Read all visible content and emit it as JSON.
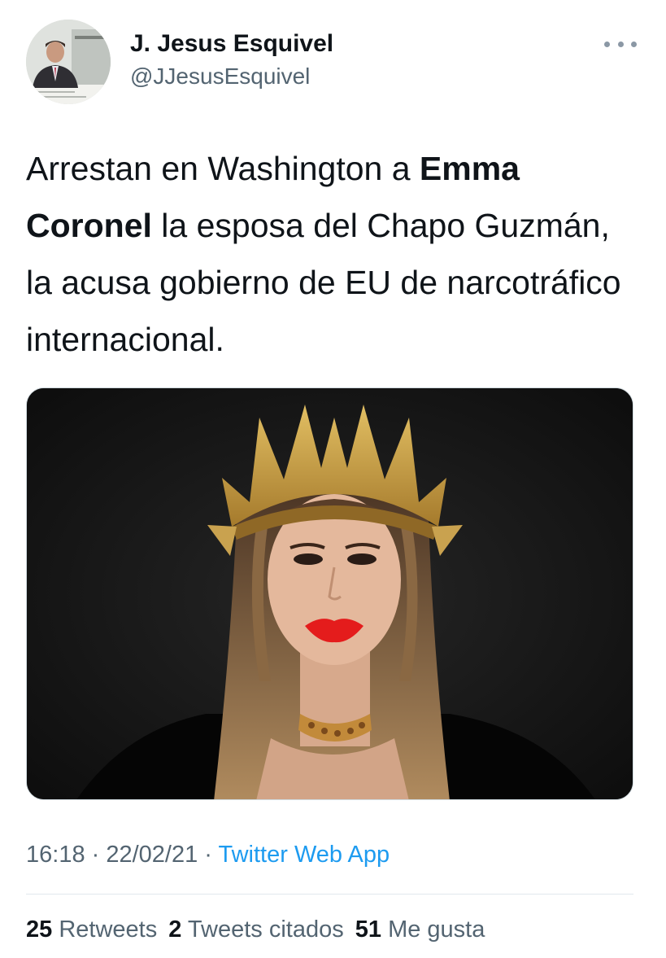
{
  "author": {
    "display_name": "J. Jesus Esquivel",
    "handle": "@JJesusEsquivel",
    "avatar_icon": "profile-photo"
  },
  "more_icon": "more-options-icon",
  "tweet": {
    "text_1": "Arrestan en Washington a ",
    "bold_1": "Emma Coronel",
    "text_2": " la esposa del Chapo Guzmán, la acusa gobierno de EU de narcotráfico internacional."
  },
  "meta": {
    "time": "16:18",
    "sep_1": " · ",
    "date": "22/02/21",
    "sep_2": " · ",
    "source": "Twitter Web App"
  },
  "stats": {
    "retweets_count": "25",
    "retweets_label": "Retweets",
    "quotes_count": "2",
    "quotes_label": "Tweets citados",
    "likes_count": "51",
    "likes_label": "Me gusta"
  },
  "colors": {
    "text": "#0f1419",
    "secondary": "#536471",
    "link": "#1d9bf0",
    "divider": "#e1e8ed"
  }
}
